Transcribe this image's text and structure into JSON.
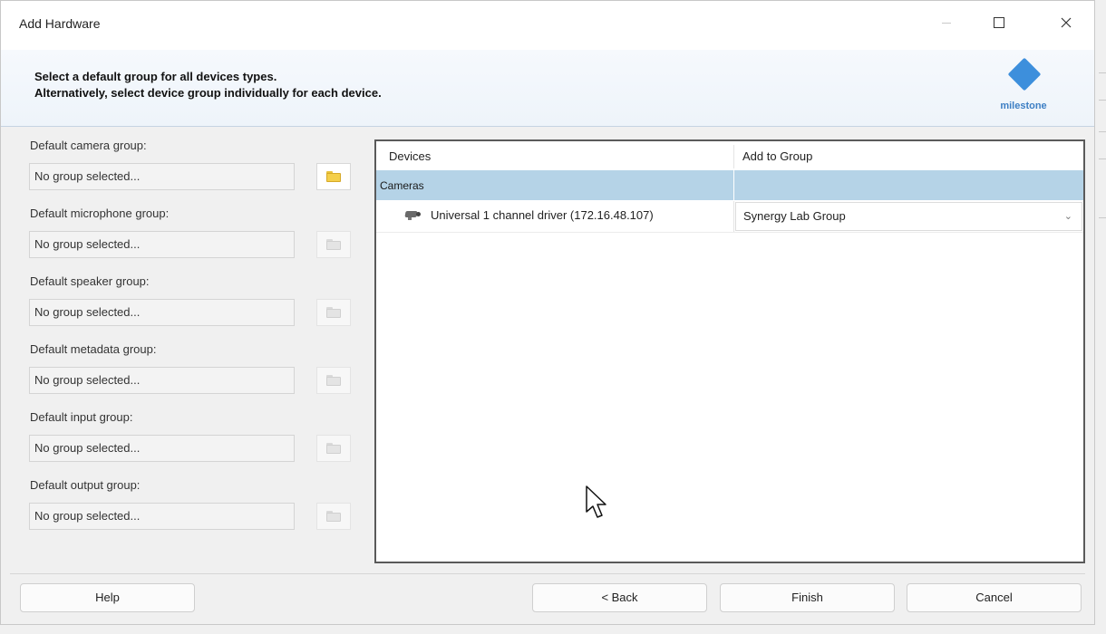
{
  "window": {
    "title": "Add Hardware"
  },
  "banner": {
    "line1": "Select a default group for all devices types.",
    "line2": "Alternatively, select device group individually for each device.",
    "logo_text": "milestone",
    "logo_color": "#3d8fdc"
  },
  "defaults": [
    {
      "label": "Default camera group:",
      "value": "No group selected...",
      "folder_enabled": true
    },
    {
      "label": "Default microphone group:",
      "value": "No group selected...",
      "folder_enabled": false
    },
    {
      "label": "Default speaker group:",
      "value": "No group selected...",
      "folder_enabled": false
    },
    {
      "label": "Default metadata group:",
      "value": "No group selected...",
      "folder_enabled": false
    },
    {
      "label": "Default input group:",
      "value": "No group selected...",
      "folder_enabled": false
    },
    {
      "label": "Default output group:",
      "value": "No group selected...",
      "folder_enabled": false
    }
  ],
  "grid": {
    "col_devices": "Devices",
    "col_group": "Add to Group",
    "category": "Cameras",
    "category_color": "#b5d3e7",
    "device": {
      "icon": "camera-icon",
      "name": "Universal 1 channel driver (172.16.48.107)",
      "group": "Synergy Lab Group"
    }
  },
  "buttons": {
    "help": "Help",
    "back": "< Back",
    "finish": "Finish",
    "cancel": "Cancel"
  }
}
